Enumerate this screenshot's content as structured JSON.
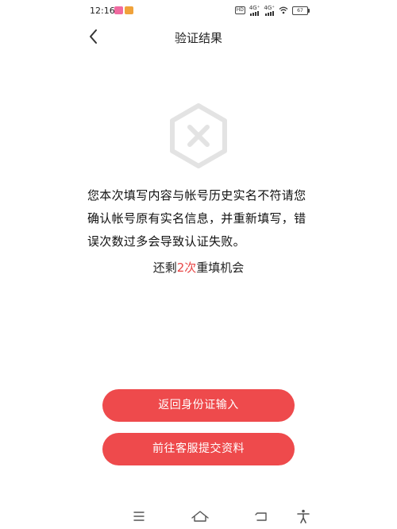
{
  "status_bar": {
    "time": "12:16",
    "network_hd": "HD",
    "sim1_type": "4G⁺",
    "sim2_type": "4G⁺",
    "battery": "67"
  },
  "nav": {
    "title": "验证结果"
  },
  "result": {
    "icon": "error-x-hexagon-icon",
    "message": "您本次填写内容与帐号历史实名不符请您确认帐号原有实名信息，并重新填写，错误次数过多会导致认证失败。",
    "retry_prefix": "还剩",
    "retry_count": "2次",
    "retry_suffix": "重填机会"
  },
  "actions": {
    "return_label": "返回身份证输入",
    "service_label": "前往客服提交资料"
  },
  "system_nav": [
    "menu-icon",
    "home-icon",
    "back-icon",
    "accessibility-icon"
  ],
  "colors": {
    "accent": "#ee4a4c",
    "highlight_text": "#e84545",
    "icon_gray": "#e3e3e3"
  }
}
